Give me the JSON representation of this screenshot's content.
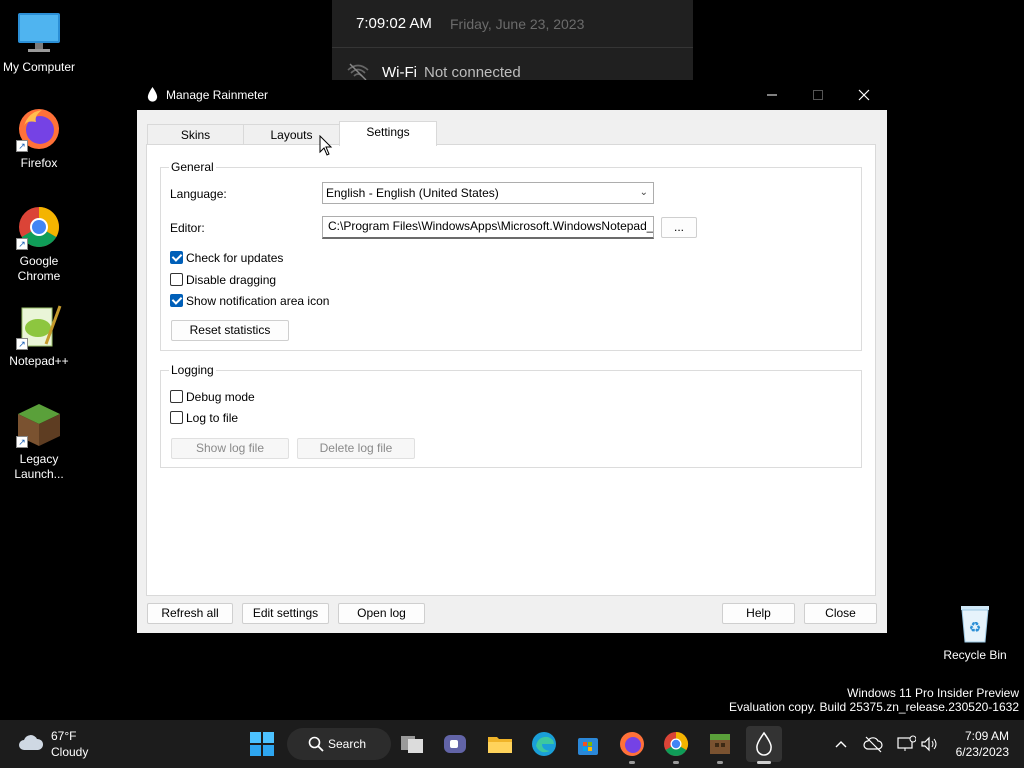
{
  "desktop": {
    "icons": [
      {
        "label": "My Computer",
        "icon": "monitor-icon"
      },
      {
        "label": "Firefox",
        "icon": "firefox-icon"
      },
      {
        "label": "Google Chrome",
        "icon": "chrome-icon"
      },
      {
        "label": "Notepad++",
        "icon": "notepadpp-icon"
      },
      {
        "label": "Legacy Launch...",
        "icon": "minecraft-grass-block-icon"
      },
      {
        "label": "Recycle Bin",
        "icon": "recycle-bin-icon"
      }
    ],
    "watermark": {
      "line1": "Windows 11 Pro Insider Preview",
      "line2": "Evaluation copy. Build 25375.zn_release.230520-1632"
    }
  },
  "flyout": {
    "time": "7:09:02 AM",
    "date": "Friday, June 23, 2023",
    "wifi_label": "Wi-Fi",
    "wifi_status": "Not connected"
  },
  "window": {
    "title": "Manage Rainmeter",
    "tabs": [
      "Skins",
      "Layouts",
      "Settings"
    ],
    "active_tab": "Settings",
    "general": {
      "legend": "General",
      "language_label": "Language:",
      "language_value": "English - English (United States)",
      "editor_label": "Editor:",
      "editor_value": "C:\\Program Files\\WindowsApps\\Microsoft.WindowsNotepad_",
      "browse_label": "...",
      "check_updates": {
        "label": "Check for updates",
        "checked": true
      },
      "disable_dragging": {
        "label": "Disable dragging",
        "checked": false
      },
      "show_tray_icon": {
        "label": "Show notification area icon",
        "checked": true
      },
      "reset_label": "Reset statistics"
    },
    "logging": {
      "legend": "Logging",
      "debug_mode": {
        "label": "Debug mode",
        "checked": false
      },
      "log_to_file": {
        "label": "Log to file",
        "checked": false
      },
      "show_log_label": "Show log file",
      "delete_log_label": "Delete log file"
    },
    "footer": {
      "refresh_all": "Refresh all",
      "edit_settings": "Edit settings",
      "open_log": "Open log",
      "help": "Help",
      "close": "Close"
    }
  },
  "taskbar": {
    "weather_temp": "67°F",
    "weather_condition": "Cloudy",
    "search_label": "Search",
    "clock_time": "7:09 AM",
    "clock_date": "6/23/2023"
  },
  "colors": {
    "accent": "#005fb8",
    "taskbar": "#1c1c1c",
    "window_bg": "#f0f0f0"
  }
}
